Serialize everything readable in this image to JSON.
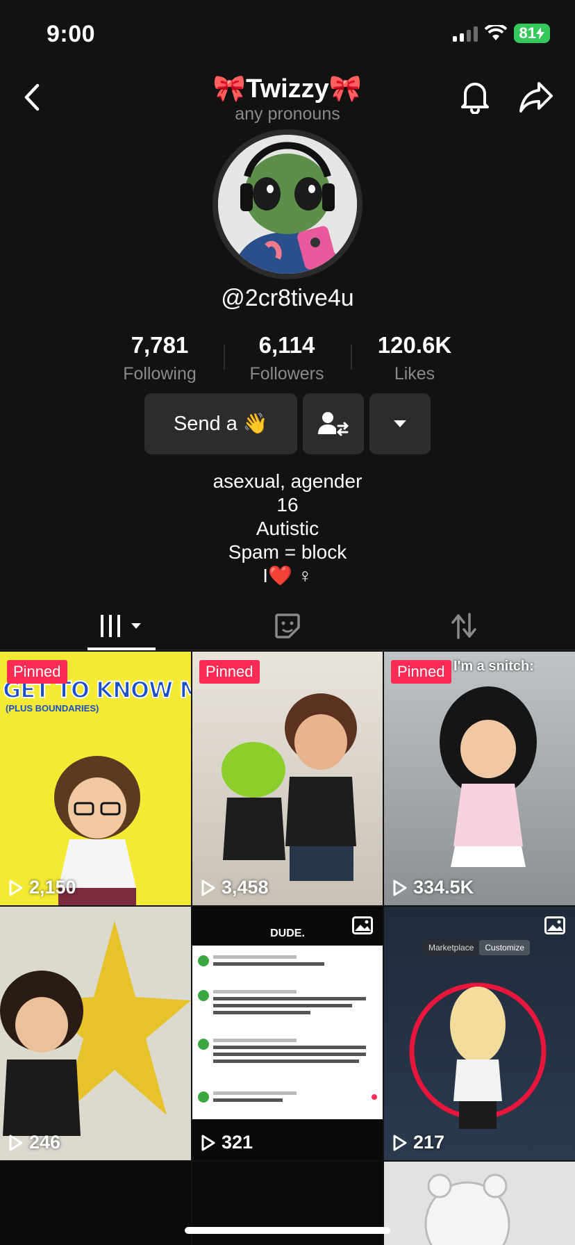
{
  "status": {
    "time": "9:00",
    "battery": "81"
  },
  "header": {
    "name": "🎀Twizzy🎀",
    "pronouns": "any pronouns"
  },
  "profile": {
    "handle": "@2cr8tive4u"
  },
  "stats": [
    {
      "value": "7,781",
      "label": "Following"
    },
    {
      "value": "6,114",
      "label": "Followers"
    },
    {
      "value": "120.6K",
      "label": "Likes"
    }
  ],
  "actions": {
    "send_label": "Send a 👋"
  },
  "bio": {
    "line1": "asexual, agender",
    "line2": "16",
    "line3": "Autistic",
    "line4": "Spam = block",
    "line5": "I❤️ ♀"
  },
  "videos": [
    {
      "pinned": "Pinned",
      "views": "2,150",
      "caption": "GET TO KNOW ME",
      "subcaption": "(PLUS BOUNDARIES)"
    },
    {
      "pinned": "Pinned",
      "views": "3,458"
    },
    {
      "pinned": "Pinned",
      "views": "334.5K",
      "caption": "I'm a snitch:"
    },
    {
      "views": "246"
    },
    {
      "views": "321",
      "caption": "DUDE."
    },
    {
      "views": "217",
      "caption": "Marketplace",
      "caption2": "Customize"
    }
  ],
  "colors": {
    "accent": "#fe2c55",
    "battery": "#34c759",
    "background": "#121212"
  }
}
